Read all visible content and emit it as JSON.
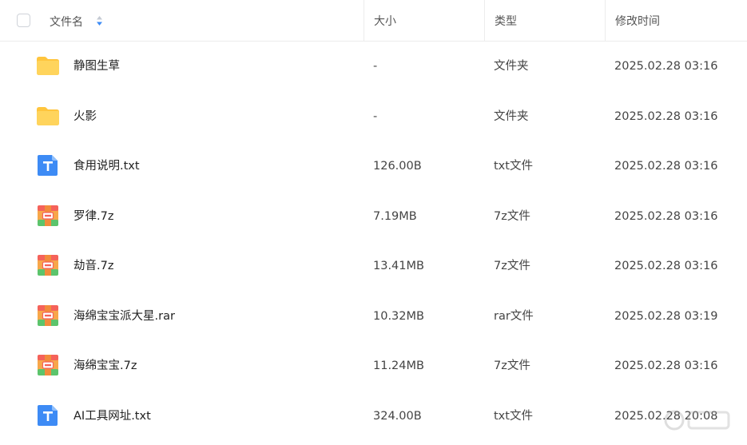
{
  "header": {
    "name": "文件名",
    "size": "大小",
    "type": "类型",
    "time": "修改时间"
  },
  "files": [
    {
      "name": "静图生草",
      "size": "-",
      "type": "文件夹",
      "time": "2025.02.28 03:16",
      "icon": "folder-icon"
    },
    {
      "name": "火影",
      "size": "-",
      "type": "文件夹",
      "time": "2025.02.28 03:16",
      "icon": "folder-icon"
    },
    {
      "name": "食用说明.txt",
      "size": "126.00B",
      "type": "txt文件",
      "time": "2025.02.28 03:16",
      "icon": "txt-file-icon"
    },
    {
      "name": "罗律.7z",
      "size": "7.19MB",
      "type": "7z文件",
      "time": "2025.02.28 03:16",
      "icon": "archive-icon"
    },
    {
      "name": "劫音.7z",
      "size": "13.41MB",
      "type": "7z文件",
      "time": "2025.02.28 03:16",
      "icon": "archive-icon"
    },
    {
      "name": "海绵宝宝派大星.rar",
      "size": "10.32MB",
      "type": "rar文件",
      "time": "2025.02.28 03:19",
      "icon": "archive-icon"
    },
    {
      "name": "海绵宝宝.7z",
      "size": "11.24MB",
      "type": "7z文件",
      "time": "2025.02.28 03:16",
      "icon": "archive-icon"
    },
    {
      "name": "AI工具网址.txt",
      "size": "324.00B",
      "type": "txt文件",
      "time": "2025.02.28 20:08",
      "icon": "txt-file-icon"
    }
  ],
  "colors": {
    "folder": "#FFC53D",
    "txt": "#3D8BF5",
    "archive_red": "#F5625A",
    "archive_green": "#5CC46C",
    "archive_orange": "#F7A74A"
  }
}
